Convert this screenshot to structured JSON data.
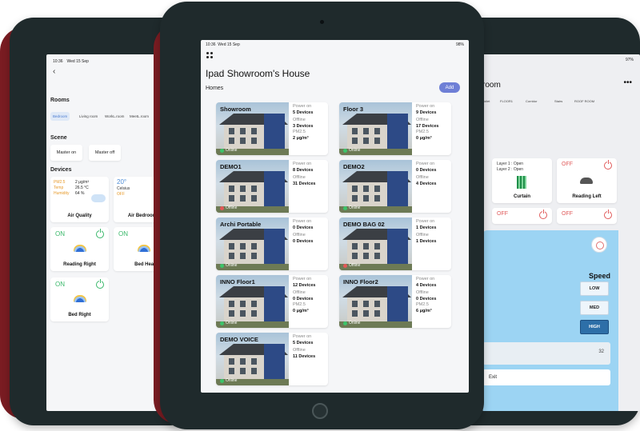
{
  "left": {
    "time": "10:36",
    "date": "Wed 15 Sep",
    "title_fragment": "S",
    "rooms_label": "Rooms",
    "rooms": [
      "Bedroom",
      "Living room",
      "WorkL.room",
      "MeetL.room"
    ],
    "scene_label": "Scene",
    "scenes": [
      "Master on",
      "Master off"
    ],
    "devices_label": "Devices",
    "air_quality": {
      "pm_label": "PM2.5",
      "pm_value": "2 μg/m³",
      "temp_label": "Temp",
      "temp_value": "26.5 °C",
      "humidity_label": "Humidity",
      "humidity_value": "64 %",
      "name": "Air Quality"
    },
    "air_bedroom": {
      "temp": "20°",
      "unit": "Celsius",
      "state": "OFF",
      "name": "Air Bedroom"
    },
    "reading_right": {
      "state": "ON",
      "name": "Reading Right"
    },
    "bed_head": {
      "state": "ON",
      "name": "Bed Head"
    },
    "bed_right": {
      "state": "ON",
      "name": "Bed Right"
    }
  },
  "center": {
    "time": "10:36",
    "date": "Wed 15 Sep",
    "battery": "98%",
    "title": "Ipad Showroom's House",
    "homes_label": "Homes",
    "add_label": "Add",
    "labels": {
      "power_on": "Power on",
      "offline": "Offline",
      "pm": "PM2.5"
    },
    "homes": [
      {
        "name": "Showroom",
        "power": "5 Devices",
        "offline": "3 Devices",
        "pm": "2 μg/m³",
        "status": "Online",
        "color": "#3cc46a"
      },
      {
        "name": "Floor 3",
        "power": "9 Devices",
        "offline": "17 Devices",
        "pm": "0 μg/m³",
        "status": "Online",
        "color": "#3cc46a"
      },
      {
        "name": "DEMO1",
        "power": "8 Devices",
        "offline": "31 Devices",
        "pm": "",
        "status": "Offline",
        "color": "#e45858"
      },
      {
        "name": "DEMO2",
        "power": "0 Devices",
        "offline": "4 Devices",
        "pm": "",
        "status": "Online",
        "color": "#3cc46a"
      },
      {
        "name": "Archi Portable",
        "power": "0 Devices",
        "offline": "0 Devices",
        "pm": "",
        "status": "Online",
        "color": "#3cc46a"
      },
      {
        "name": "DEMO BAG 02",
        "power": "1 Devices",
        "offline": "1 Devices",
        "pm": "",
        "status": "Offline",
        "color": "#e45858"
      },
      {
        "name": "INNO Floor1",
        "power": "12 Devices",
        "offline": "0 Devices",
        "pm": "0 μg/m³",
        "status": "Online",
        "color": "#3cc46a"
      },
      {
        "name": "INNO Floor2",
        "power": "4 Devices",
        "offline": "0 Devices",
        "pm": "6 μg/m³",
        "status": "Online",
        "color": "#3cc46a"
      },
      {
        "name": "DEMO VOICE",
        "power": "5 Devices",
        "offline": "11 Devices",
        "pm": "",
        "status": "Online",
        "color": "#3cc46a"
      }
    ]
  },
  "right": {
    "battery": "97%",
    "title_fragment": "room",
    "tabs": [
      "Toilet",
      "FLOOR1",
      "Corridor",
      "Stairs",
      "ROOF ROOM"
    ],
    "curtain": {
      "layer1": "Layer 1 : Open",
      "layer2": "Layer 2 : Open",
      "name": "Curtain"
    },
    "reading_left": {
      "state": "OFF",
      "name": "Reading Left"
    },
    "off_a": "OFF",
    "off_b": "OFF",
    "speed_label": "Speed",
    "speeds": [
      "LOW",
      "MED",
      "HIGH"
    ],
    "selected_speed": "HIGH",
    "temp_value": "32",
    "exit_label": "Exit"
  }
}
